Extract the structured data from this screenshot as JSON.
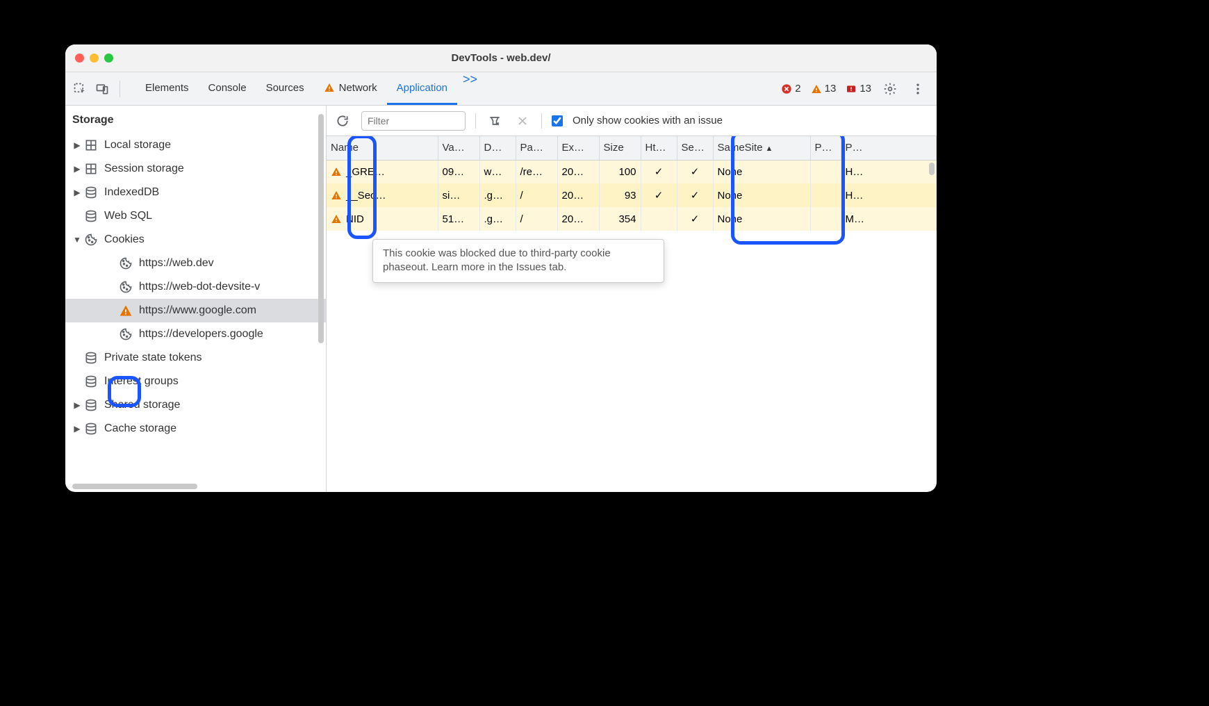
{
  "window": {
    "title": "DevTools - web.dev/"
  },
  "tabs": {
    "elements": "Elements",
    "console": "Console",
    "sources": "Sources",
    "network": "Network",
    "application": "Application",
    "moreGlyph": ">>"
  },
  "status": {
    "errors": "2",
    "warnings": "13",
    "messages": "13"
  },
  "sidebar": {
    "header": "Storage",
    "items": [
      {
        "kind": "top",
        "expandable": true,
        "expanded": false,
        "icon": "grid",
        "label": "Local storage"
      },
      {
        "kind": "top",
        "expandable": true,
        "expanded": false,
        "icon": "grid",
        "label": "Session storage"
      },
      {
        "kind": "top",
        "expandable": true,
        "expanded": false,
        "icon": "db",
        "label": "IndexedDB"
      },
      {
        "kind": "top",
        "expandable": false,
        "expanded": false,
        "icon": "db",
        "label": "Web SQL"
      },
      {
        "kind": "top",
        "expandable": true,
        "expanded": true,
        "icon": "cookie",
        "label": "Cookies"
      },
      {
        "kind": "sub",
        "icon": "cookie",
        "label": "https://web.dev"
      },
      {
        "kind": "sub",
        "icon": "cookie",
        "label": "https://web-dot-devsite-v"
      },
      {
        "kind": "sub",
        "icon": "warn",
        "label": "https://www.google.com",
        "selected": true
      },
      {
        "kind": "sub",
        "icon": "cookie",
        "label": "https://developers.google"
      },
      {
        "kind": "top",
        "expandable": false,
        "icon": "db",
        "label": "Private state tokens"
      },
      {
        "kind": "top",
        "expandable": false,
        "icon": "db",
        "label": "Interest groups"
      },
      {
        "kind": "top",
        "expandable": true,
        "expanded": false,
        "icon": "db",
        "label": "Shared storage"
      },
      {
        "kind": "top",
        "expandable": true,
        "expanded": false,
        "icon": "db",
        "label": "Cache storage"
      }
    ]
  },
  "filterbar": {
    "placeholder": "Filter",
    "onlyIssuesLabel": "Only show cookies with an issue",
    "onlyIssuesChecked": true
  },
  "table": {
    "columns": {
      "name": "Name",
      "value": "Va…",
      "domain": "D…",
      "path": "Pa…",
      "expires": "Ex…",
      "size": "Size",
      "http": "Ht…",
      "secure": "Se…",
      "samesite": "SameSite",
      "partition": "P…",
      "priority": "P…"
    },
    "sort": {
      "col": "samesite",
      "dir": "asc",
      "glyph": "▲"
    },
    "rows": [
      {
        "name": "_GRE…",
        "value": "09…",
        "domain": "w…",
        "path": "/re…",
        "expires": "20…",
        "size": "100",
        "http": "✓",
        "secure": "✓",
        "samesite": "None",
        "partition": "",
        "priority": "H…"
      },
      {
        "name": "__Sec…",
        "value": "si…",
        "domain": ".g…",
        "path": "/",
        "expires": "20…",
        "size": "93",
        "http": "✓",
        "secure": "✓",
        "samesite": "None",
        "partition": "",
        "priority": "H…"
      },
      {
        "name": "NID",
        "value": "51…",
        "domain": ".g…",
        "path": "/",
        "expires": "20…",
        "size": "354",
        "http": "",
        "secure": "✓",
        "samesite": "None",
        "partition": "",
        "priority": "M…"
      }
    ]
  },
  "tooltip": "This cookie was blocked due to third-party cookie phaseout. Learn more in the Issues tab."
}
